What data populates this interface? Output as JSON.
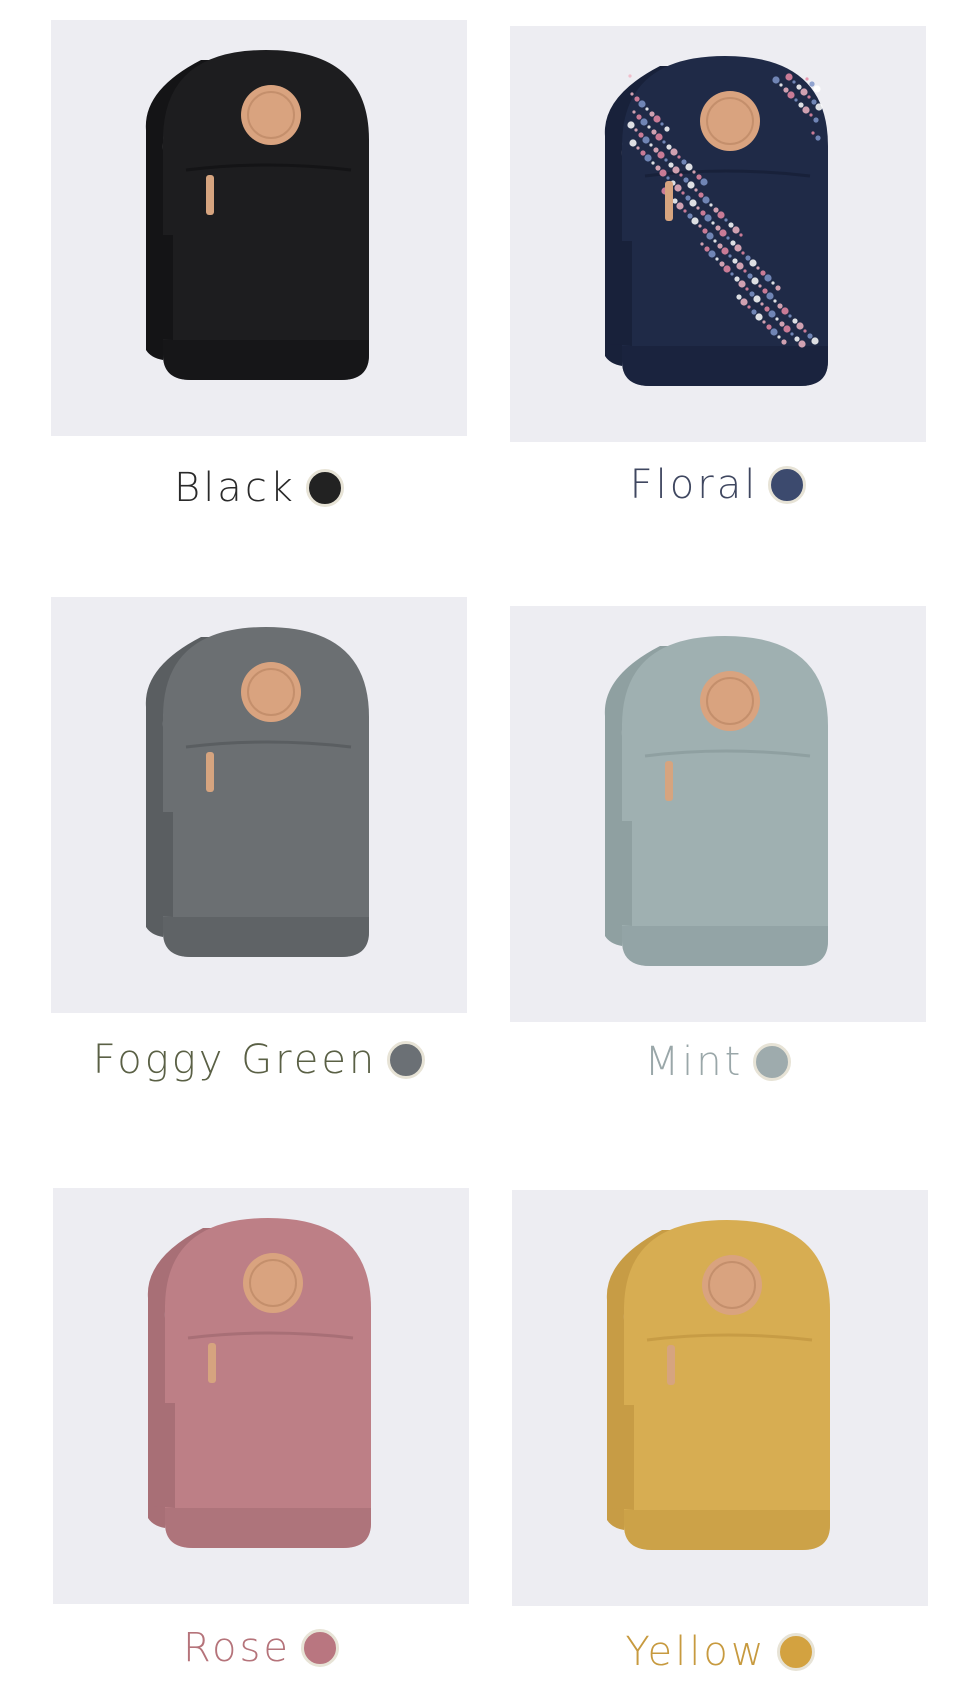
{
  "swatches": [
    {
      "label": "Black",
      "text_color": "#2a2a2a",
      "dot_color": "#222222",
      "bag_color": "#1d1d1f",
      "bag_shade": "#141416",
      "pattern": false
    },
    {
      "label": "Floral",
      "text_color": "#3f4760",
      "dot_color": "#3c4a6e",
      "bag_color": "#1f2a47",
      "bag_shade": "#18213a",
      "pattern": true
    },
    {
      "label": "Foggy Green",
      "text_color": "#5a6045",
      "dot_color": "#6b7075",
      "bag_color": "#6b6f72",
      "bag_shade": "#5a5e61",
      "pattern": false
    },
    {
      "label": "Mint",
      "text_color": "#9aa7a9",
      "dot_color": "#9eabad",
      "bag_color": "#9fb0b1",
      "bag_shade": "#8fa0a1",
      "pattern": false
    },
    {
      "label": "Rose",
      "text_color": "#b5737a",
      "dot_color": "#b97680",
      "bag_color": "#bd7f86",
      "bag_shade": "#a86f76",
      "pattern": false
    },
    {
      "label": "Yellow",
      "text_color": "#c79a3f",
      "dot_color": "#d3a240",
      "bag_color": "#d7ad52",
      "bag_shade": "#c79c45",
      "pattern": false
    }
  ]
}
